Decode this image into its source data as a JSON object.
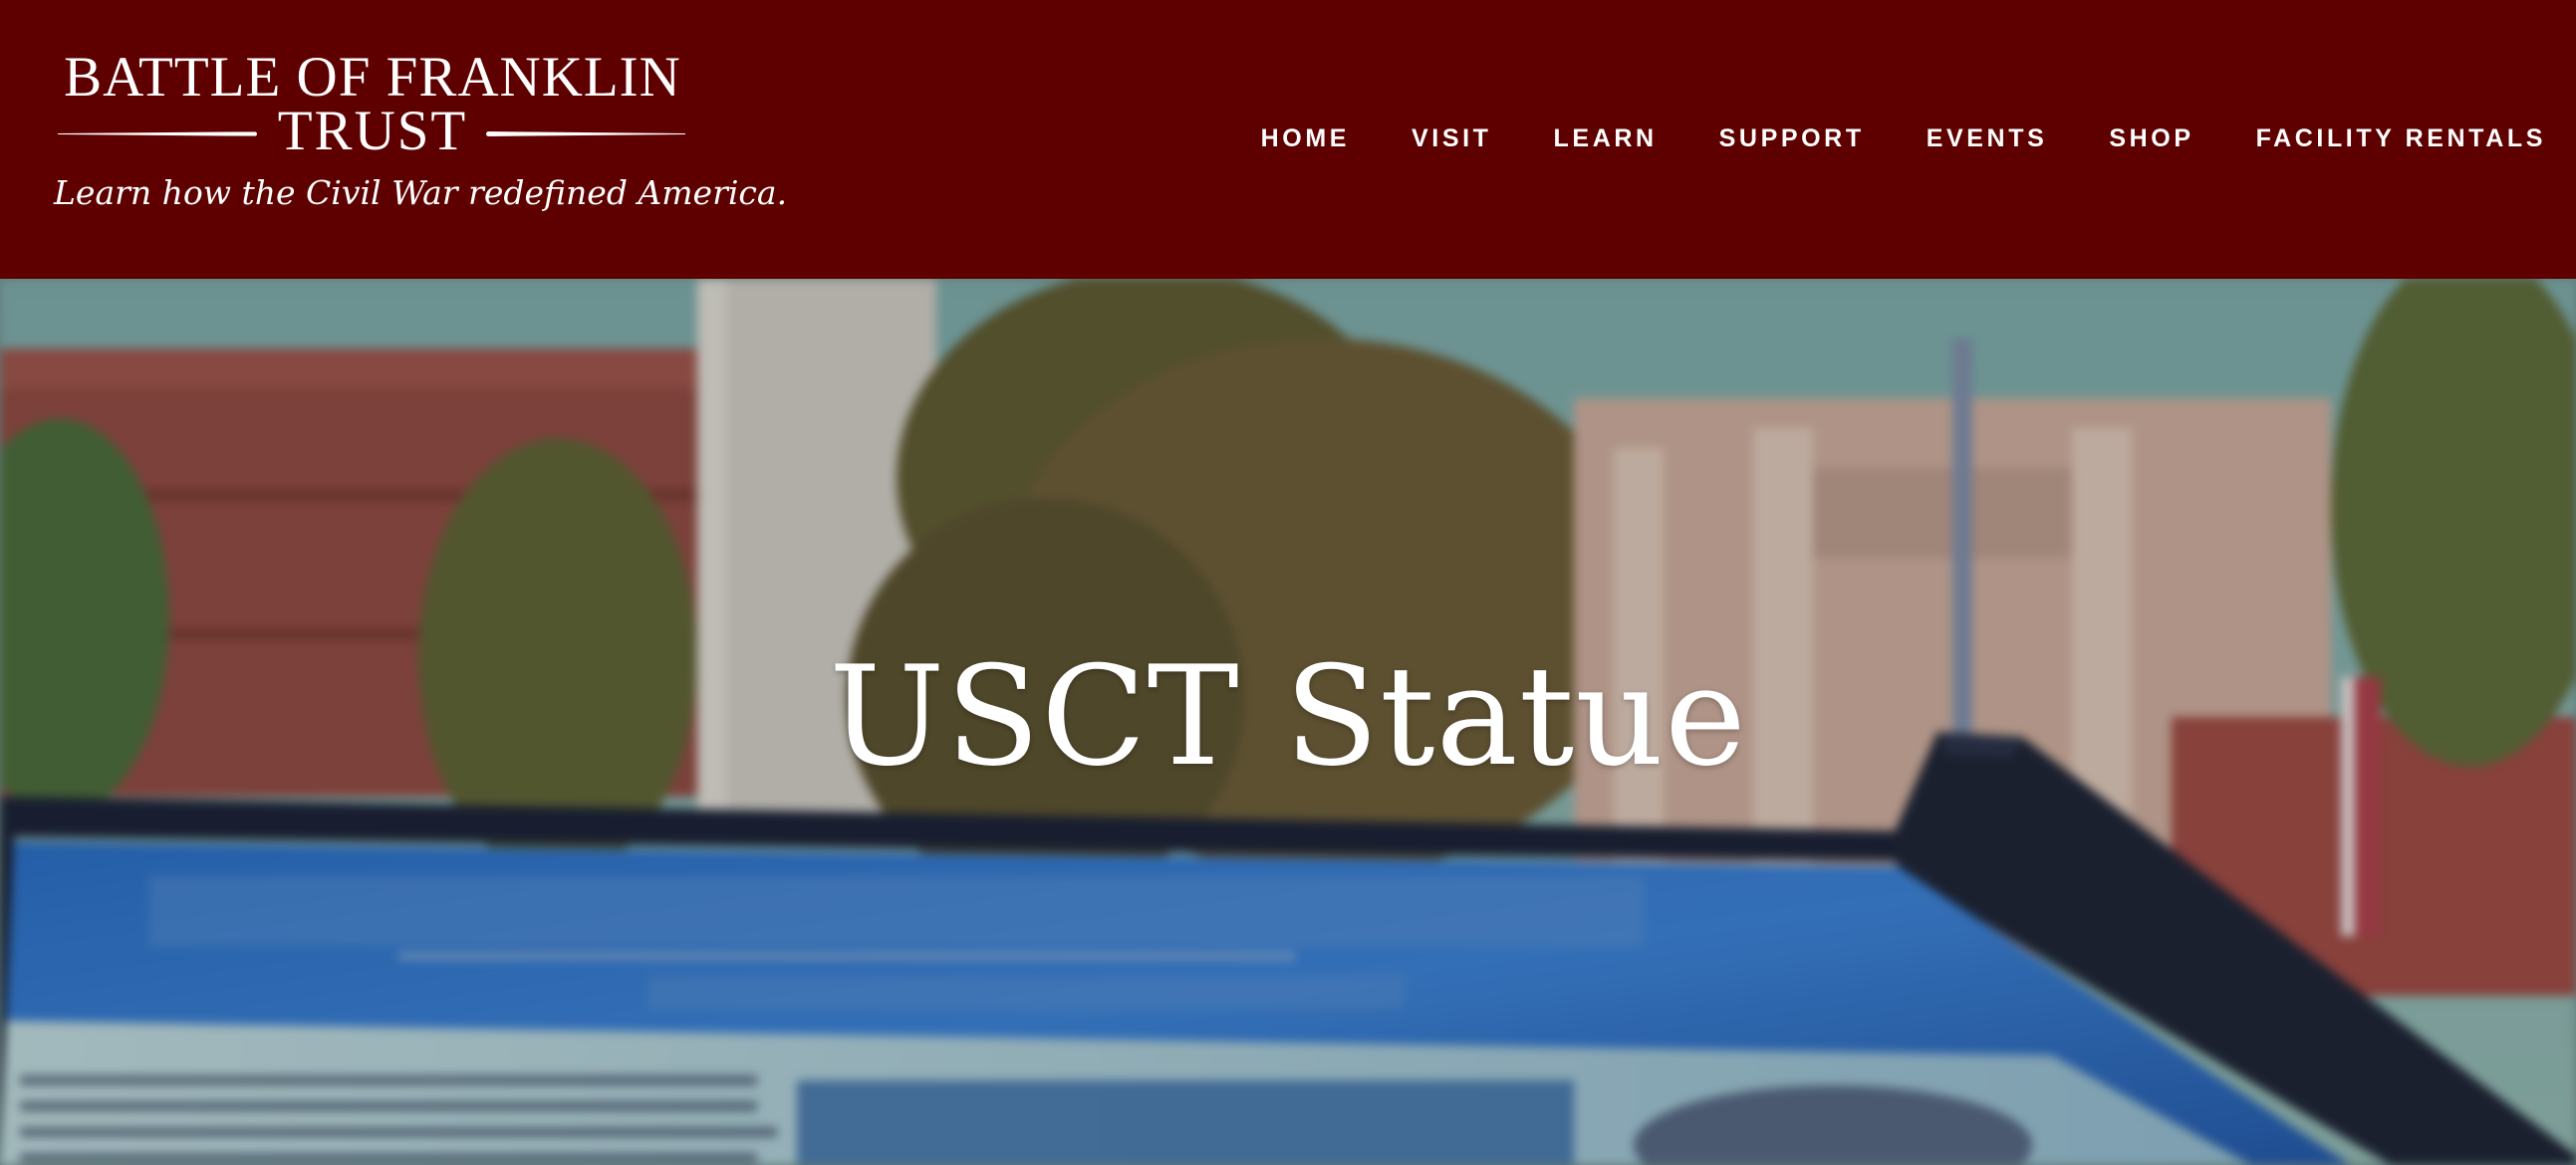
{
  "header": {
    "logo": {
      "line1": "BATTLE OF FRANKLIN",
      "line2": "TRUST",
      "tagline": "Learn how the Civil War redefined America."
    },
    "nav": [
      {
        "label": "HOME"
      },
      {
        "label": "VISIT"
      },
      {
        "label": "LEARN"
      },
      {
        "label": "SUPPORT"
      },
      {
        "label": "EVENTS"
      },
      {
        "label": "SHOP"
      },
      {
        "label": "FACILITY RENTALS"
      }
    ]
  },
  "hero": {
    "title": "USCT Statue",
    "image": {
      "description_icon": "historical-marker-photo",
      "marker_heading": "U.S. COLORED TROOPS (USCT)",
      "marker_subheading": "Doing Justice to Their Share",
      "marker_body": [
        "After the Emancipation Proclamation was issued,",
        "the U.S. War Department created the Bureau of",
        "Colored Troops on May 22, 1863. Approximately",
        "200,000 African Americans ever enlisted to"
      ]
    }
  },
  "colors": {
    "brand": "#5e0000",
    "text_on_brand": "#ffffff"
  }
}
